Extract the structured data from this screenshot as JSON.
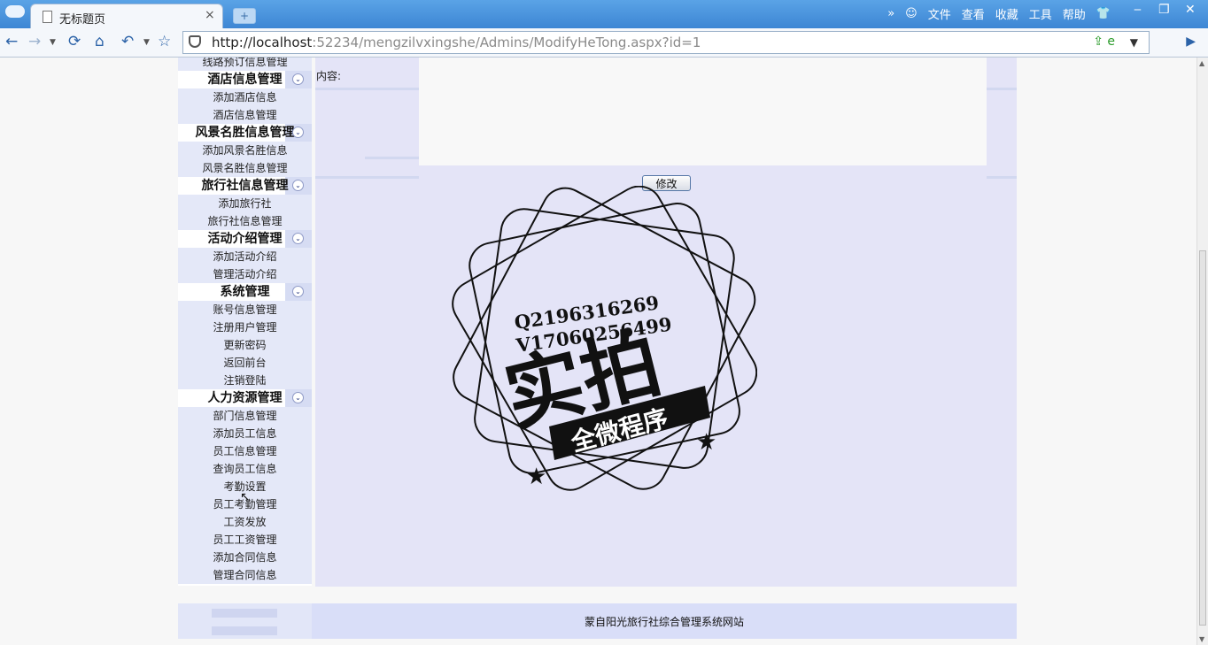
{
  "browser": {
    "tab_title": "无标题页",
    "tab_close": "×",
    "new_tab": "+",
    "menu_overflow": "»",
    "menu": [
      "文件",
      "查看",
      "收藏",
      "工具",
      "帮助"
    ],
    "url_host": "http://localhost",
    "url_rest": ":52234/mengzilvxingshe/Admins/ModifyHeTong.aspx?id=1",
    "window": {
      "minimize": "‒",
      "restore": "❐",
      "close": "✕"
    }
  },
  "sidebar": {
    "items": [
      {
        "kind": "item",
        "label": "线路预订信息管理"
      },
      {
        "kind": "head",
        "label": "酒店信息管理"
      },
      {
        "kind": "item",
        "label": "添加酒店信息"
      },
      {
        "kind": "item",
        "label": "酒店信息管理"
      },
      {
        "kind": "head",
        "label": "风景名胜信息管理"
      },
      {
        "kind": "item",
        "label": "添加风景名胜信息"
      },
      {
        "kind": "item",
        "label": "风景名胜信息管理"
      },
      {
        "kind": "head",
        "label": "旅行社信息管理"
      },
      {
        "kind": "item",
        "label": "添加旅行社"
      },
      {
        "kind": "item",
        "label": "旅行社信息管理"
      },
      {
        "kind": "head",
        "label": "活动介绍管理"
      },
      {
        "kind": "item",
        "label": "添加活动介绍"
      },
      {
        "kind": "item",
        "label": "管理活动介绍"
      },
      {
        "kind": "head",
        "label": "系统管理"
      },
      {
        "kind": "item",
        "label": "账号信息管理"
      },
      {
        "kind": "item",
        "label": "注册用户管理"
      },
      {
        "kind": "item",
        "label": "更新密码"
      },
      {
        "kind": "item",
        "label": "返回前台"
      },
      {
        "kind": "item",
        "label": "注销登陆"
      },
      {
        "kind": "head",
        "label": "人力资源管理"
      },
      {
        "kind": "item",
        "label": "部门信息管理"
      },
      {
        "kind": "item",
        "label": "添加员工信息"
      },
      {
        "kind": "item",
        "label": "员工信息管理"
      },
      {
        "kind": "item",
        "label": "查询员工信息"
      },
      {
        "kind": "item",
        "label": "考勤设置"
      },
      {
        "kind": "item",
        "label": "员工考勤管理"
      },
      {
        "kind": "item",
        "label": "工资发放"
      },
      {
        "kind": "item",
        "label": "员工工资管理"
      },
      {
        "kind": "item",
        "label": "添加合同信息"
      },
      {
        "kind": "item",
        "label": "管理合同信息"
      }
    ]
  },
  "form": {
    "content_label": "内容:",
    "content_value": "",
    "submit_label": "修改"
  },
  "watermark": {
    "line1": "Q2196316269",
    "line2": "V17060256499",
    "big": "实拍",
    "ribbon": "全微程序"
  },
  "footer": {
    "text": "蒙自阳光旅行社综合管理系统网站"
  }
}
